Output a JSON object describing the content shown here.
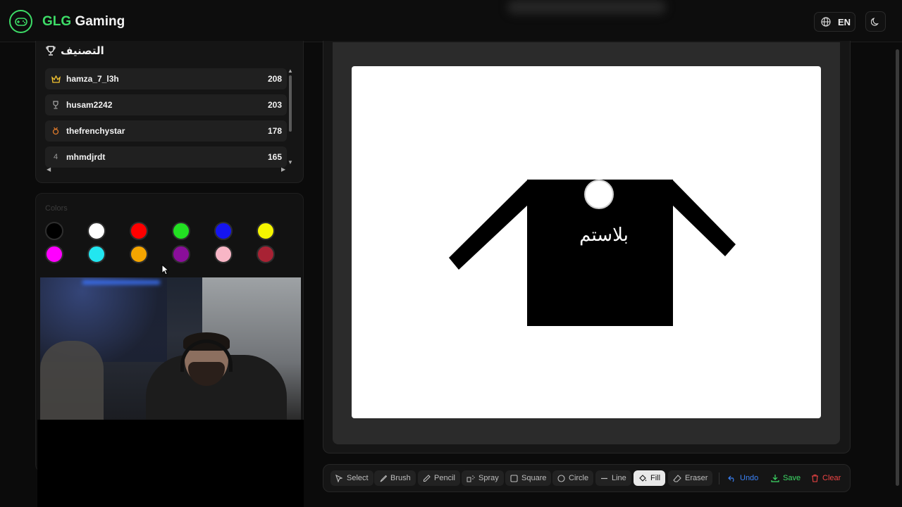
{
  "header": {
    "brand_accent": "GLG",
    "brand_rest": " Gaming",
    "language": "EN"
  },
  "leaderboard": {
    "title": "التصنيف",
    "rows": [
      {
        "rank": "1",
        "icon": "crown-icon",
        "name": "hamza_7_l3h",
        "score": "208"
      },
      {
        "rank": "2",
        "icon": "trophy-icon",
        "name": "husam2242",
        "score": "203"
      },
      {
        "rank": "3",
        "icon": "medal-icon",
        "name": "thefrenchystar",
        "score": "178"
      },
      {
        "rank": "4",
        "icon": "",
        "name": "mhmdjrdt",
        "score": "165"
      }
    ]
  },
  "colors": {
    "title": "Colors",
    "swatches": [
      "#000000",
      "#ffffff",
      "#ff0000",
      "#22e022",
      "#1515f0",
      "#f5f500",
      "#ff00ff",
      "#22e6f0",
      "#f5a500",
      "#8a0e9a",
      "#f8b6c6",
      "#a82234",
      "#8a8a8a",
      "#0c0c8a",
      "#0a8a0a",
      "#8a0a0a",
      "#8a8a0a",
      "#d6d6d6"
    ]
  },
  "canvas": {
    "drawing_text": "بلاستم"
  },
  "toolbar": {
    "select": "Select",
    "brush": "Brush",
    "pencil": "Pencil",
    "spray": "Spray",
    "square": "Square",
    "circle": "Circle",
    "line": "Line",
    "fill": "Fill",
    "eraser": "Eraser",
    "undo": "Undo",
    "save": "Save",
    "clear": "Clear",
    "active_tool": "Fill"
  },
  "accent_color": "#3ddc67"
}
